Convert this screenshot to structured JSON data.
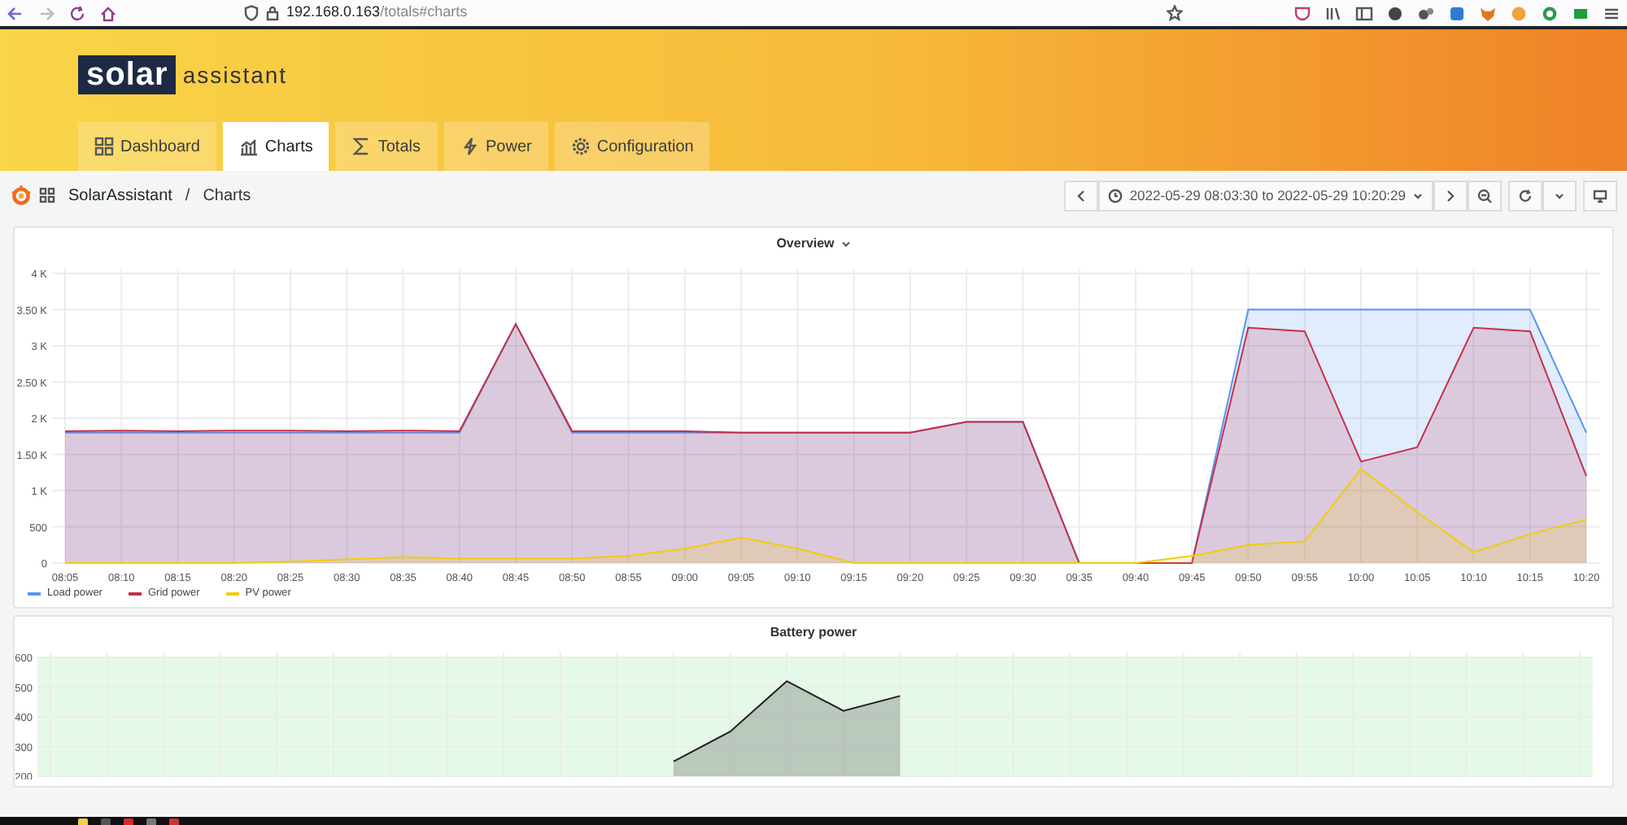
{
  "browser": {
    "url_host": "192.168.0.163",
    "url_path": "/totals#charts"
  },
  "logo": {
    "word_1": "solar",
    "word_2": "assistant"
  },
  "tabs": [
    {
      "label": "Dashboard",
      "selected": false
    },
    {
      "label": "Charts",
      "selected": true
    },
    {
      "label": "Totals",
      "selected": false
    },
    {
      "label": "Power",
      "selected": false
    },
    {
      "label": "Configuration",
      "selected": false
    }
  ],
  "breadcrumb": {
    "root": "SolarAssistant",
    "separator": "/",
    "current": "Charts"
  },
  "time_range": {
    "label": "2022-05-29 08:03:30 to 2022-05-29 10:20:29"
  },
  "panels": [
    {
      "title": "Overview",
      "chart_data": {
        "type": "area",
        "grid": true,
        "categories": [
          "08:05",
          "08:10",
          "08:15",
          "08:20",
          "08:25",
          "08:30",
          "08:35",
          "08:40",
          "08:45",
          "08:50",
          "08:55",
          "09:00",
          "09:05",
          "09:10",
          "09:15",
          "09:20",
          "09:25",
          "09:30",
          "09:35",
          "09:40",
          "09:45",
          "09:50",
          "09:55",
          "10:00",
          "10:05",
          "10:10",
          "10:15",
          "10:20"
        ],
        "ylim": [
          0,
          4000
        ],
        "yticks": [
          0,
          500,
          {
            "value": 1000,
            "label": "1 K"
          },
          {
            "value": 1500,
            "label": "1.50 K"
          },
          {
            "value": 2000,
            "label": "2 K"
          },
          {
            "value": 2500,
            "label": "2.50 K"
          },
          {
            "value": 3000,
            "label": "3 K"
          },
          {
            "value": 3500,
            "label": "3.50 K"
          },
          {
            "value": 4000,
            "label": "4 K"
          }
        ],
        "series": [
          {
            "name": "Load power",
            "color": "#5794f2",
            "values": [
              1800,
              1800,
              1800,
              1800,
              1800,
              1800,
              1800,
              1800,
              3300,
              1800,
              1800,
              1800,
              1800,
              1800,
              1800,
              1800,
              1950,
              1950,
              0,
              0,
              0,
              3500,
              3500,
              3500,
              3500,
              3500,
              3500,
              1800
            ]
          },
          {
            "name": "Grid power",
            "color": "#c4314b",
            "values": [
              1820,
              1830,
              1820,
              1830,
              1830,
              1820,
              1830,
              1820,
              3300,
              1820,
              1820,
              1820,
              1800,
              1800,
              1800,
              1800,
              1950,
              1950,
              0,
              0,
              0,
              3250,
              3200,
              1400,
              1600,
              3250,
              3200,
              1200
            ]
          },
          {
            "name": "PV power",
            "color": "#f2cc0c",
            "values": [
              0,
              0,
              0,
              0,
              20,
              50,
              80,
              60,
              60,
              60,
              100,
              200,
              350,
              200,
              0,
              0,
              0,
              0,
              0,
              0,
              100,
              250,
              300,
              1300,
              700,
              150,
              400,
              600
            ]
          }
        ]
      }
    },
    {
      "title": "Battery power",
      "chart_data": {
        "type": "area",
        "grid": true,
        "ylim": [
          200,
          600
        ],
        "yticks": [
          200,
          300,
          400,
          500,
          600
        ],
        "series": [
          {
            "color": "#1f1f1f",
            "values": [
              null,
              null,
              null,
              null,
              null,
              null,
              null,
              null,
              null,
              null,
              null,
              250,
              350,
              520,
              420,
              470,
              null,
              null,
              null,
              null,
              null,
              null,
              null,
              null,
              null,
              null,
              null,
              null
            ]
          }
        ]
      }
    }
  ]
}
